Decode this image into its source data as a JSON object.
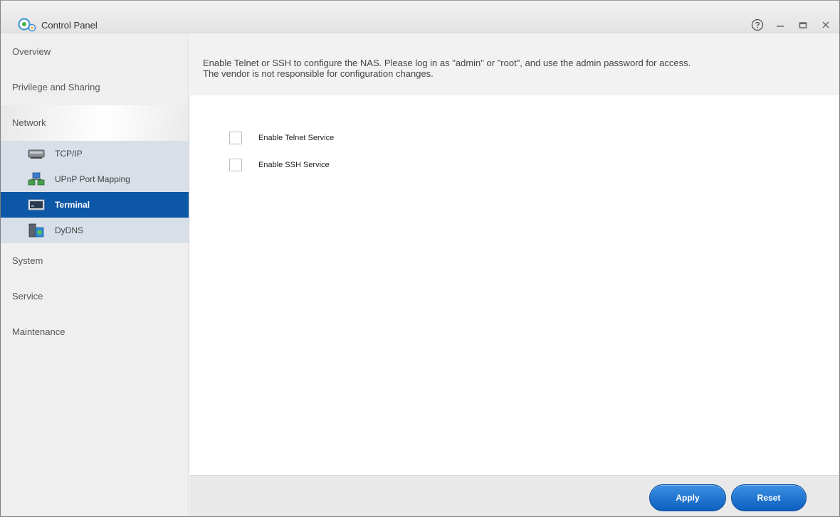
{
  "window": {
    "title": "Control Panel",
    "controls": [
      "help-icon",
      "minimize-icon",
      "maximize-icon",
      "close-icon"
    ]
  },
  "sidebar": {
    "sections": [
      {
        "label": "Overview"
      },
      {
        "label": "Privilege and Sharing"
      },
      {
        "label": "Network",
        "active": true
      }
    ],
    "network_items": [
      {
        "label": "TCP/IP",
        "icon": "network-card-icon"
      },
      {
        "label": "UPnP Port Mapping",
        "icon": "upnp-icon"
      },
      {
        "label": "Terminal",
        "icon": "terminal-icon",
        "selected": true
      },
      {
        "label": "DyDNS",
        "icon": "dydns-icon"
      }
    ],
    "sections_after": [
      {
        "label": "System"
      },
      {
        "label": "Service"
      },
      {
        "label": "Maintenance"
      }
    ]
  },
  "main": {
    "notice_line1": "Enable Telnet or SSH to configure the NAS. Please log in as \"admin\" or \"root\", and use the admin password for access.",
    "notice_line2": "The vendor is not responsible for configuration changes.",
    "options": [
      {
        "label": "Enable Telnet Service",
        "checked": false
      },
      {
        "label": "Enable SSH Service",
        "checked": false
      }
    ]
  },
  "footer": {
    "apply_label": "Apply",
    "reset_label": "Reset"
  },
  "colors": {
    "accent": "#0c57a6",
    "subnav_bg": "#d9dfe8",
    "button": "#1a6fd1"
  }
}
